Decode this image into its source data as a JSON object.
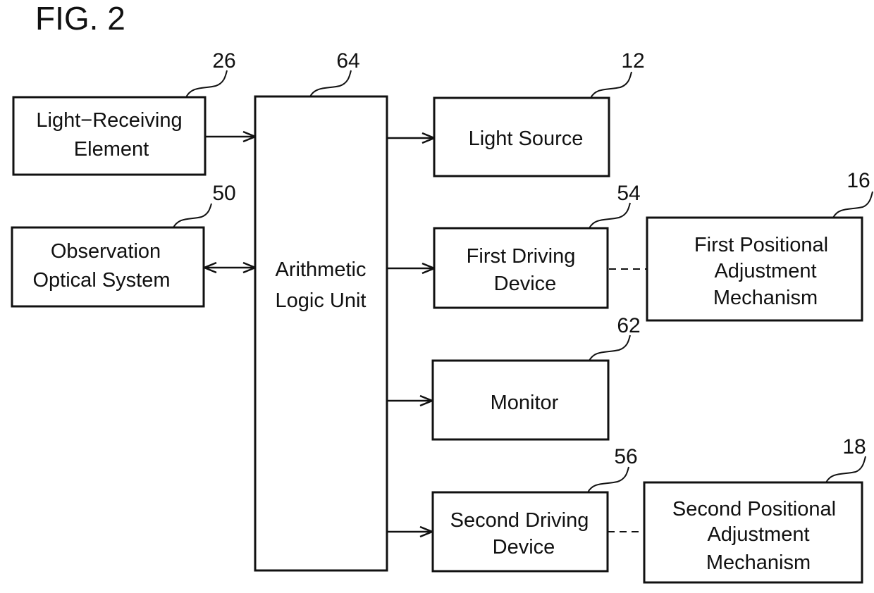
{
  "figure_title": "FIG. 2",
  "blocks": {
    "light_receiving": {
      "ref": "26",
      "lines": [
        "Light−Receiving",
        "Element"
      ]
    },
    "observation": {
      "ref": "50",
      "lines": [
        "Observation",
        "Optical System"
      ]
    },
    "alu": {
      "ref": "64",
      "lines": [
        "Arithmetic",
        "Logic Unit"
      ]
    },
    "light_source": {
      "ref": "12",
      "lines": [
        "Light Source"
      ]
    },
    "first_driving": {
      "ref": "54",
      "lines": [
        "First Driving",
        "Device"
      ]
    },
    "first_positional": {
      "ref": "16",
      "lines": [
        "First Positional",
        "Adjustment",
        "Mechanism"
      ]
    },
    "monitor": {
      "ref": "62",
      "lines": [
        "Monitor"
      ]
    },
    "second_driving": {
      "ref": "56",
      "lines": [
        "Second Driving",
        "Device"
      ]
    },
    "second_positional": {
      "ref": "18",
      "lines": [
        "Second Positional",
        "Adjustment",
        "Mechanism"
      ]
    }
  },
  "connections": [
    {
      "from": "light_receiving",
      "to": "alu",
      "type": "arrow"
    },
    {
      "from": "observation",
      "to": "alu",
      "type": "bidirectional"
    },
    {
      "from": "alu",
      "to": "light_source",
      "type": "arrow"
    },
    {
      "from": "alu",
      "to": "first_driving",
      "type": "arrow"
    },
    {
      "from": "alu",
      "to": "monitor",
      "type": "arrow"
    },
    {
      "from": "alu",
      "to": "second_driving",
      "type": "arrow"
    },
    {
      "from": "first_driving",
      "to": "first_positional",
      "type": "dashed"
    },
    {
      "from": "second_driving",
      "to": "second_positional",
      "type": "dashed"
    }
  ]
}
